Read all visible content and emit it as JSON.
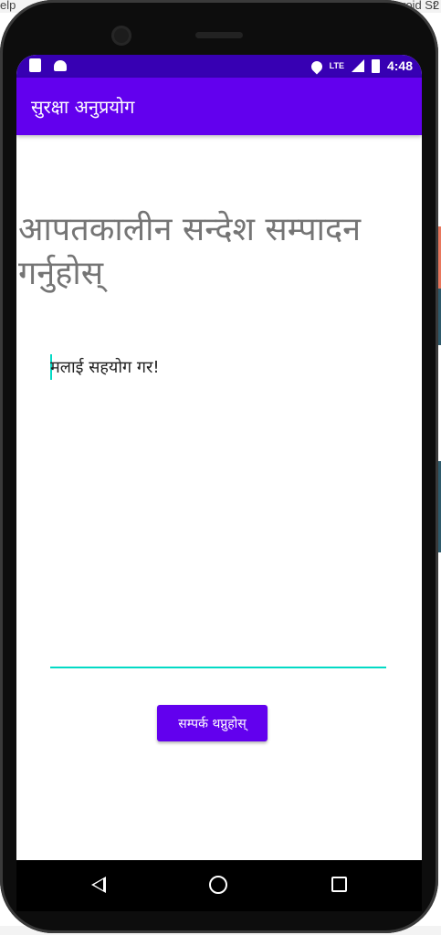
{
  "desktop": {
    "menu_fragment": "elp",
    "right_fragment": "roid St",
    "right_number": "2"
  },
  "status_bar": {
    "time": "4:48",
    "network": "LTE"
  },
  "app_bar": {
    "title": "सुरक्षा अनुप्रयोग"
  },
  "heading": "आपतकालीन सन्देश सम्पादन गर्नुहोस्",
  "message_field": {
    "value": "मलाई सहयोग गर!"
  },
  "contact_button": {
    "label": "सम्पर्क थप्नुहोस्"
  },
  "nav_bar": {
    "icons": [
      "back-icon",
      "home-icon",
      "recents-icon"
    ]
  },
  "colors": {
    "primary": "#6200ee",
    "primary_dark": "#3700b3",
    "accent": "#03dac5"
  }
}
